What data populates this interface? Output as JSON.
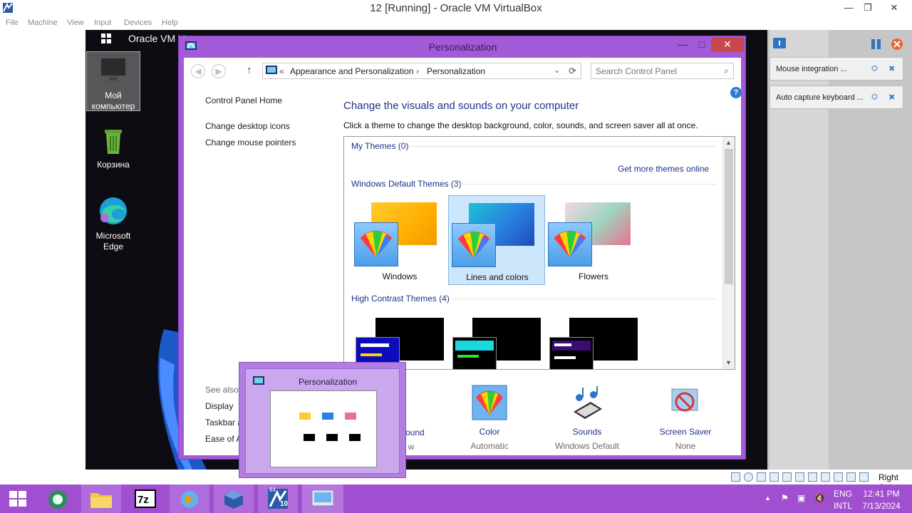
{
  "host_window": {
    "title": "12 [Running] - Oracle VM VirtualBox",
    "controls": {
      "minimize": "—",
      "maximize": "❐",
      "close": "✕"
    },
    "menu": [
      "File",
      "Machine",
      "View",
      "Input",
      "Devices",
      "Help"
    ]
  },
  "guest": {
    "topbar_text": "Oracle VM V",
    "desktop_icons": [
      {
        "label": "Мой компьютер",
        "icon": "computer-icon"
      },
      {
        "label": "Корзина",
        "icon": "recycle-bin-icon"
      },
      {
        "label": "Microsoft Edge",
        "icon": "edge-icon"
      }
    ]
  },
  "side_panel": {
    "notifications": [
      {
        "text": "Mouse integration ..."
      },
      {
        "text": "Auto capture keyboard ..."
      }
    ]
  },
  "personalization": {
    "title": "Personalization",
    "controls": {
      "minimize": "—",
      "maximize": "□",
      "close": "✕"
    },
    "address": {
      "chevrons": "«",
      "crumb1": "Appearance and Personalization",
      "sep": "›",
      "crumb2": "Personalization"
    },
    "search_placeholder": "Search Control Panel",
    "left_links": [
      "Control Panel Home",
      "Change desktop icons",
      "Change mouse pointers"
    ],
    "heading": "Change the visuals and sounds on your computer",
    "subheading": "Click a theme to change the desktop background, color, sounds, and screen saver all at once.",
    "my_themes_label": "My Themes (0)",
    "get_more": "Get more themes online",
    "default_themes_label": "Windows Default Themes (3)",
    "default_themes": [
      "Windows",
      "Lines and colors",
      "Flowers"
    ],
    "selected_theme": "Lines and colors",
    "high_contrast_label": "High Contrast Themes (4)",
    "see_also": {
      "label": "See also",
      "links": [
        "Display",
        "Taskbar a",
        "Ease of A"
      ]
    },
    "bottom": [
      {
        "title": "ground",
        "value": "w"
      },
      {
        "title": "Color",
        "value": "Automatic"
      },
      {
        "title": "Sounds",
        "value": "Windows Default"
      },
      {
        "title": "Screen Saver",
        "value": "None"
      }
    ]
  },
  "preview": {
    "title": "Personalization"
  },
  "statusbar": {
    "host_key": "Right Ctrl"
  },
  "taskbar": {
    "tray": {
      "lang_top": "ENG",
      "lang_bottom": "INTL",
      "time": "12:41 PM",
      "date": "7/13/2024"
    },
    "badges": {
      "vbox64": "64",
      "vbox10": "10"
    }
  },
  "colors": {
    "accent": "#a35ad9",
    "taskbar": "#9f4fcf",
    "link": "#1e3287"
  }
}
